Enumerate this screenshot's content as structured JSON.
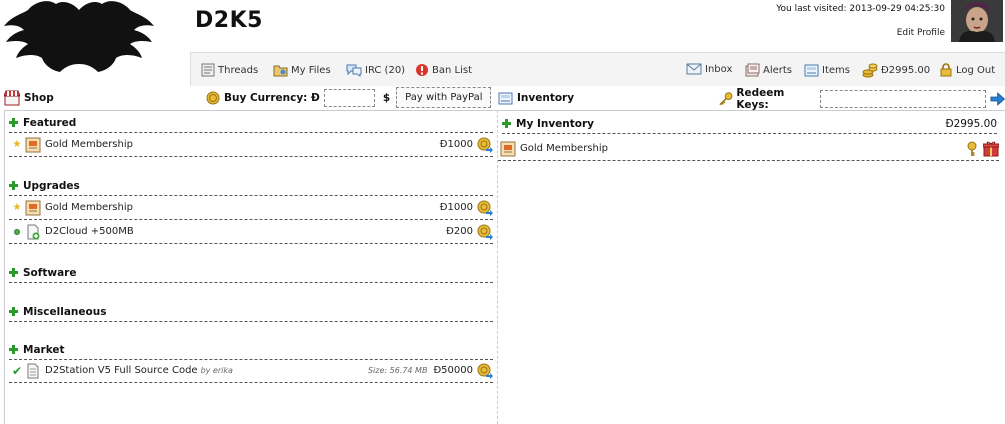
{
  "header": {
    "site_title": "D2K5",
    "last_visited": "You last visited: 2013-09-29 04:25:30",
    "edit_profile": "Edit Profile"
  },
  "nav": {
    "threads": "Threads",
    "my_files": "My Files",
    "irc": "IRC (20)",
    "ban_list": "Ban List",
    "inbox": "Inbox",
    "alerts": "Alerts",
    "items": "Items",
    "balance": "Đ2995.00",
    "log_out": "Log Out"
  },
  "shop_bar": {
    "title": "Shop",
    "buy_currency_label": "Buy Currency: Đ",
    "dollar_label": "$",
    "paypal_button": "Pay with PayPal",
    "currency_value": ""
  },
  "inventory_bar": {
    "title": "Inventory",
    "redeem_label": "Redeem Keys:",
    "redeem_value": ""
  },
  "shop": {
    "featured": {
      "title": "Featured",
      "items": [
        {
          "name": "Gold Membership",
          "price": "Đ1000"
        }
      ]
    },
    "upgrades": {
      "title": "Upgrades",
      "items": [
        {
          "name": "Gold Membership",
          "price": "Đ1000"
        },
        {
          "name": "D2Cloud +500MB",
          "price": "Đ200"
        }
      ]
    },
    "software": {
      "title": "Software"
    },
    "miscellaneous": {
      "title": "Miscellaneous"
    },
    "market": {
      "title": "Market",
      "items": [
        {
          "name": "D2Station V5 Full Source Code",
          "by": "by erika",
          "size": "Size: 56.74 MB",
          "price": "Đ50000"
        }
      ]
    }
  },
  "inventory": {
    "title": "My Inventory",
    "balance": "Đ2995.00",
    "items": [
      {
        "name": "Gold Membership"
      }
    ]
  },
  "colors": {
    "accent_green": "#2a9a2a",
    "coin_gold": "#d9a520",
    "link_blue": "#2a7fd4"
  }
}
